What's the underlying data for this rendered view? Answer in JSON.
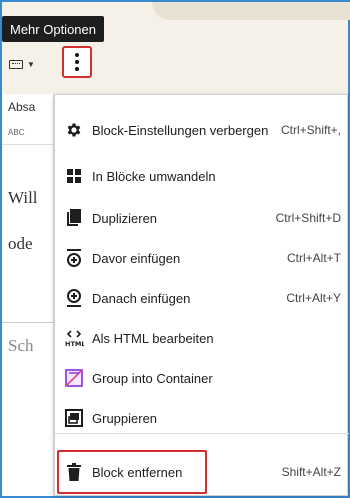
{
  "tooltip": {
    "text": "Mehr Optionen"
  },
  "toolbar": {
    "format_icon": "keyboard-icon",
    "more_icon": "vertical-dots-icon"
  },
  "editor": {
    "panel_label": "Absa",
    "tab_label": "ABC",
    "lines": [
      "Will",
      "ode",
      "Sch"
    ]
  },
  "menu": {
    "items": [
      {
        "icon": "gear-icon",
        "label": "Block-Einstellungen verbergen",
        "shortcut": "Ctrl+Shift+,"
      },
      {
        "icon": "grid-icon",
        "label": "In Blöcke umwandeln",
        "shortcut": ""
      },
      {
        "icon": "copy-icon",
        "label": "Duplizieren",
        "shortcut": "Ctrl+Shift+D"
      },
      {
        "icon": "insert-before-icon",
        "label": "Davor einfügen",
        "shortcut": "Ctrl+Alt+T"
      },
      {
        "icon": "insert-after-icon",
        "label": "Danach einfügen",
        "shortcut": "Ctrl+Alt+Y"
      },
      {
        "icon": "html-icon",
        "label": "Als HTML bearbeiten",
        "shortcut": ""
      },
      {
        "icon": "group-container-icon",
        "label": "Group into Container",
        "shortcut": ""
      },
      {
        "icon": "group-icon",
        "label": "Gruppieren",
        "shortcut": ""
      },
      {
        "icon": "trash-icon",
        "label": "Block entfernen",
        "shortcut": "Shift+Alt+Z"
      }
    ]
  },
  "colors": {
    "highlight": "#d32f2f",
    "tooltip_bg": "#1e1e1e",
    "group_container_accent": "#8a2be2"
  }
}
